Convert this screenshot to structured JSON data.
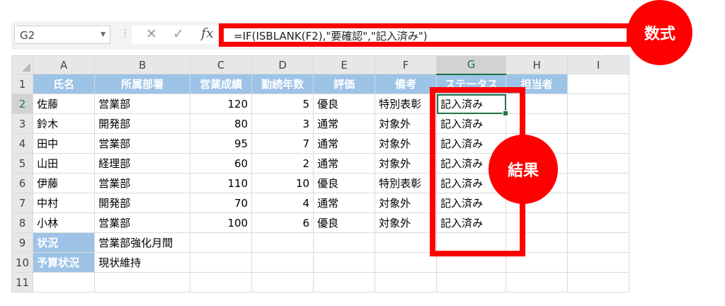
{
  "formula_bar": {
    "name_box": "G2",
    "formula": "=IF(ISBLANK(F2),\"要確認\",\"記入済み\")"
  },
  "columns": [
    "A",
    "B",
    "C",
    "D",
    "E",
    "F",
    "G",
    "H",
    "I"
  ],
  "header_row": [
    "氏名",
    "所属部署",
    "営業成績",
    "勤続年数",
    "評価",
    "備考",
    "ステータス",
    "担当者"
  ],
  "rows": [
    {
      "num": "2",
      "name": "佐藤",
      "dept": "営業部",
      "sales": "120",
      "years": "5",
      "eval": "優良",
      "note": "特別表彰",
      "status": "記入済み"
    },
    {
      "num": "3",
      "name": "鈴木",
      "dept": "開発部",
      "sales": "80",
      "years": "3",
      "eval": "通常",
      "note": "対象外",
      "status": "記入済み"
    },
    {
      "num": "4",
      "name": "田中",
      "dept": "営業部",
      "sales": "95",
      "years": "7",
      "eval": "通常",
      "note": "対象外",
      "status": "記入済み"
    },
    {
      "num": "5",
      "name": "山田",
      "dept": "経理部",
      "sales": "60",
      "years": "2",
      "eval": "通常",
      "note": "対象外",
      "status": "記入済み"
    },
    {
      "num": "6",
      "name": "伊藤",
      "dept": "営業部",
      "sales": "110",
      "years": "10",
      "eval": "優良",
      "note": "特別表彰",
      "status": "記入済み"
    },
    {
      "num": "7",
      "name": "中村",
      "dept": "開発部",
      "sales": "70",
      "years": "4",
      "eval": "通常",
      "note": "対象外",
      "status": "記入済み"
    },
    {
      "num": "8",
      "name": "小林",
      "dept": "営業部",
      "sales": "100",
      "years": "6",
      "eval": "優良",
      "note": "対象外",
      "status": "記入済み"
    }
  ],
  "extra_rows": [
    {
      "num": "9",
      "label": "状況",
      "value": "営業部強化月間"
    },
    {
      "num": "10",
      "label": "予算状況",
      "value": "現状維持"
    },
    {
      "num": "11",
      "label": "",
      "value": ""
    }
  ],
  "row1_num": "1",
  "annotations": {
    "formula_label": "数式",
    "result_label": "結果",
    "color": "#ff0000"
  },
  "colors": {
    "header_fill": "#9dc3e6",
    "selection": "#217346"
  }
}
